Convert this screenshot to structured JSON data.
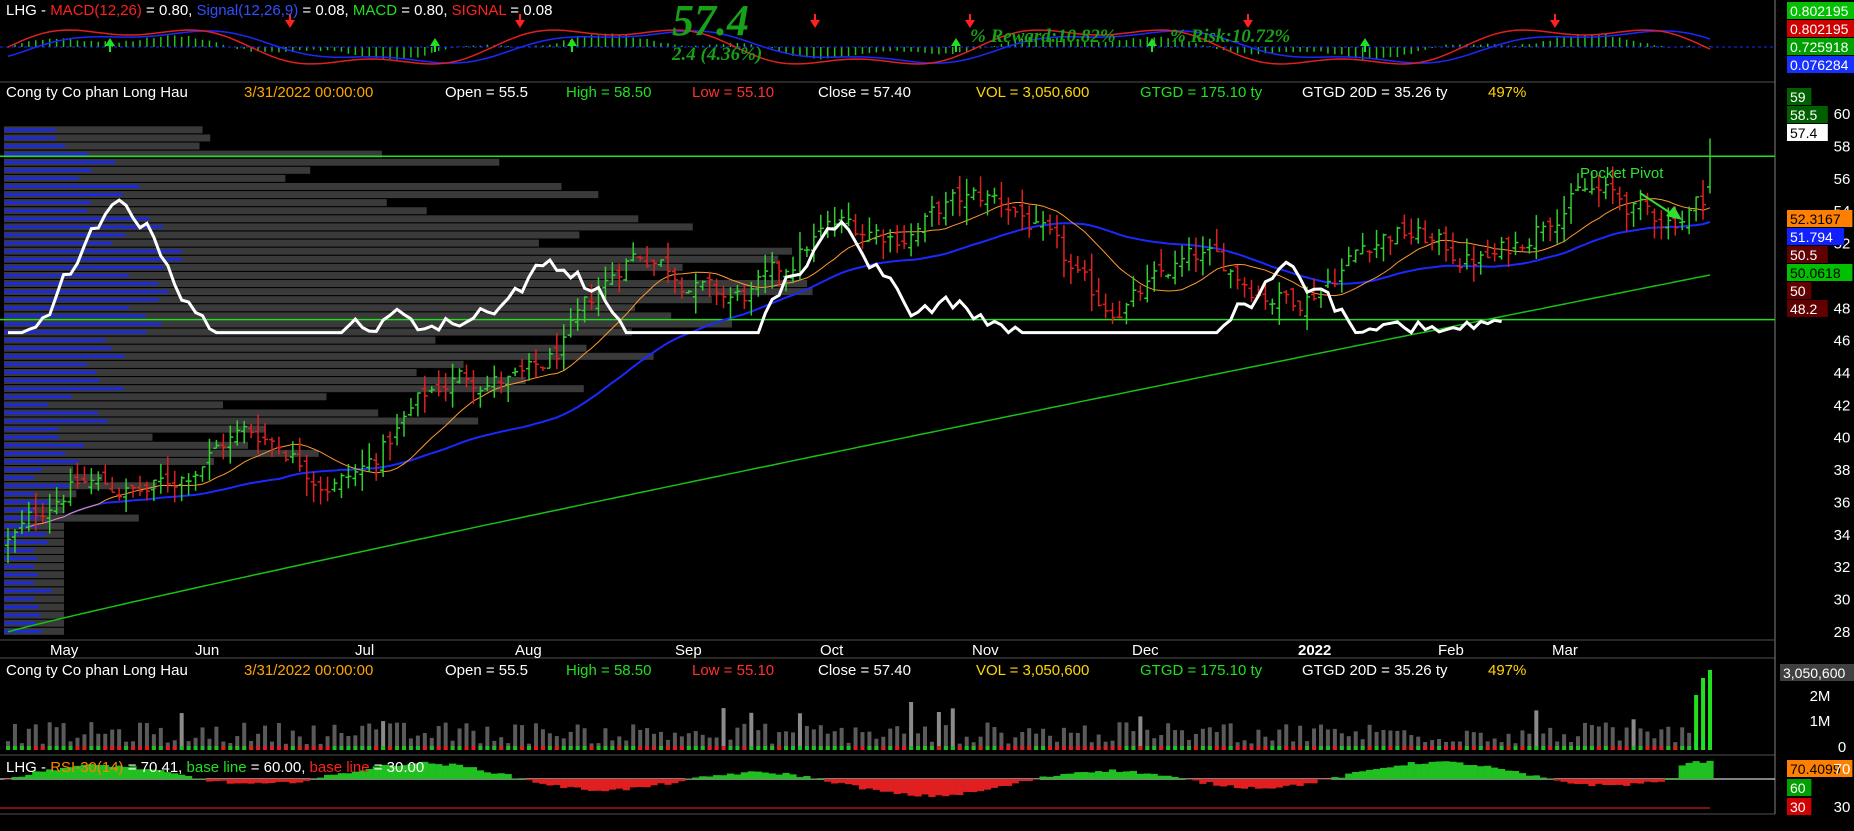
{
  "macd_panel": {
    "header": [
      {
        "text": "LHG - ",
        "color": "#ffffff"
      },
      {
        "text": "MACD(12,26)",
        "color": "#ff2020"
      },
      {
        "text": " = 0.80, ",
        "color": "#ffffff"
      },
      {
        "text": "Signal(12,26,9)",
        "color": "#3050ff"
      },
      {
        "text": " = 0.08, ",
        "color": "#ffffff"
      },
      {
        "text": "MACD",
        "color": "#20e020"
      },
      {
        "text": " = 0.80, ",
        "color": "#ffffff"
      },
      {
        "text": "SIGNAL",
        "color": "#ff2020"
      },
      {
        "text": " = 0.08",
        "color": "#ffffff"
      }
    ],
    "big_price": "57.4",
    "change": "2.4 (4.36%)",
    "reward": "% Reward:10.82%",
    "risk": "% Risk:10.72%",
    "axis_labels": [
      {
        "text": "0.802195",
        "bg": "#00c000"
      },
      {
        "text": "0.802195",
        "bg": "#d00000"
      },
      {
        "text": "0.725918",
        "bg": "#00a000"
      },
      {
        "text": "0.076284",
        "bg": "#1830ff"
      }
    ]
  },
  "info_bar": {
    "company": "Cong ty Co phan Long Hau",
    "date": "3/31/2022 00:00:00",
    "open": "Open = 55.5",
    "high": "High = 58.50",
    "low": "Low = 55.10",
    "close": "Close = 57.40",
    "vol": "VOL = 3,050,600",
    "gtgd": "GTGD = 175.10  ty",
    "gtgd20": "GTGD 20D = 35.26  ty",
    "pct": "497%"
  },
  "price_panel": {
    "annotation": "Pocket Pivot",
    "price_labels": [
      {
        "text": "59",
        "bg": "#006000",
        "color": "#ffffff"
      },
      {
        "text": "58.5",
        "bg": "#006000",
        "color": "#ffffff"
      },
      {
        "text": "57.4",
        "bg": "#ffffff",
        "color": "#000000"
      },
      {
        "text": "52.3167",
        "bg": "#ff8000",
        "color": "#000000"
      },
      {
        "text": "51.794",
        "bg": "#1020ff",
        "color": "#ffffff"
      },
      {
        "text": "50.5",
        "bg": "#600000",
        "color": "#ffffff"
      },
      {
        "text": "50.0618",
        "bg": "#00c000",
        "color": "#000000"
      },
      {
        "text": "50",
        "bg": "#600000",
        "color": "#ffffff"
      },
      {
        "text": "48.2",
        "bg": "#600000",
        "color": "#ffffff"
      }
    ]
  },
  "chart_data": {
    "type": "candlestick",
    "title": "LHG",
    "y_ticks": [
      28,
      30,
      32,
      34,
      36,
      38,
      40,
      42,
      44,
      46,
      48,
      50,
      52,
      54,
      56,
      58,
      60
    ],
    "ylim": [
      27,
      61
    ],
    "months": [
      "May",
      "Jun",
      "Jul",
      "Aug",
      "Sep",
      "Oct",
      "Nov",
      "Dec",
      "2022",
      "Feb",
      "Mar"
    ],
    "monthly_close_approx": [
      {
        "month": "May",
        "close": 37.5
      },
      {
        "month": "Jun",
        "close": 38.5
      },
      {
        "month": "Jul",
        "close": 44.5
      },
      {
        "month": "Aug",
        "close": 50.0
      },
      {
        "month": "Sep",
        "close": 48.5
      },
      {
        "month": "Oct",
        "close": 55.5
      },
      {
        "month": "Nov",
        "close": 51.0
      },
      {
        "month": "Dec",
        "close": 49.5
      },
      {
        "month": "2022",
        "close": 50.0
      },
      {
        "month": "Feb",
        "close": 53.5
      },
      {
        "month": "Mar",
        "close": 57.4
      }
    ],
    "last_bar": {
      "open": 55.5,
      "high": 58.5,
      "low": 55.1,
      "close": 57.4
    },
    "horizontal_lines": [
      57.4,
      47.3
    ],
    "series": [
      {
        "name": "MA20",
        "color": "#ff9a30"
      },
      {
        "name": "MA50",
        "color": "#1a2aff"
      },
      {
        "name": "MA200",
        "color": "#18c018"
      }
    ],
    "volume_ticks": [
      "3,050,600",
      "2M",
      "1M",
      "0"
    ],
    "rsi_ticks": [
      "70.4099",
      "60",
      "30"
    ]
  },
  "volume_panel": {
    "axis_labels": [
      {
        "text": "3,050,600",
        "bg": "#404040",
        "color": "#ffffff"
      },
      {
        "text": "2M"
      },
      {
        "text": "1M"
      },
      {
        "text": "0"
      }
    ]
  },
  "rsi_panel": {
    "header": [
      {
        "text": "LHG - ",
        "color": "#ffffff"
      },
      {
        "text": "RSI-30(14)",
        "color": "#ff8000"
      },
      {
        "text": " = 70.41, ",
        "color": "#ffffff"
      },
      {
        "text": "base line",
        "color": "#20e020"
      },
      {
        "text": " = 60.00, ",
        "color": "#ffffff"
      },
      {
        "text": "base line",
        "color": "#ff2020"
      },
      {
        "text": " = 30.00",
        "color": "#ffffff"
      }
    ],
    "axis_labels": [
      {
        "text": "70.4099",
        "bg": "#ff8000",
        "color": "#000000"
      },
      {
        "text": "60",
        "bg": "#00a000",
        "color": "#ffffff"
      },
      {
        "text": "30",
        "bg": "#d00000",
        "color": "#ffffff"
      }
    ],
    "axis_ticks": [
      "70",
      "30"
    ]
  },
  "colors": {
    "bg": "#000000",
    "up": "#30d030",
    "down": "#e02020",
    "panel_border": "#606060"
  }
}
